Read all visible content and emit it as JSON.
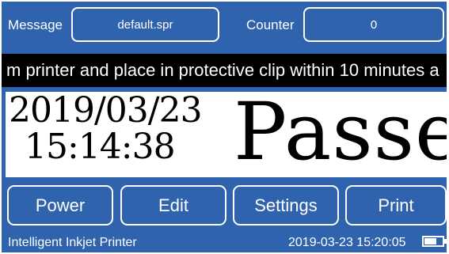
{
  "header": {
    "message_label": "Message",
    "message_value": "default.spr",
    "counter_label": "Counter",
    "counter_value": "0"
  },
  "ticker": {
    "text": "m printer and place in protective clip within 10 minutes a"
  },
  "preview": {
    "date": "2019/03/23",
    "time": "15:14:38",
    "main_text": "Passed"
  },
  "buttons": {
    "power": "Power",
    "edit": "Edit",
    "settings": "Settings",
    "print": "Print"
  },
  "status": {
    "device_name": "Intelligent Inkjet Printer",
    "datetime": "2019-03-23 15:20:05",
    "battery_icon": "battery-icon",
    "battery_level": 0.7
  },
  "colors": {
    "background": "#2f63ad",
    "ticker_bg": "#000000",
    "text": "#ffffff"
  }
}
